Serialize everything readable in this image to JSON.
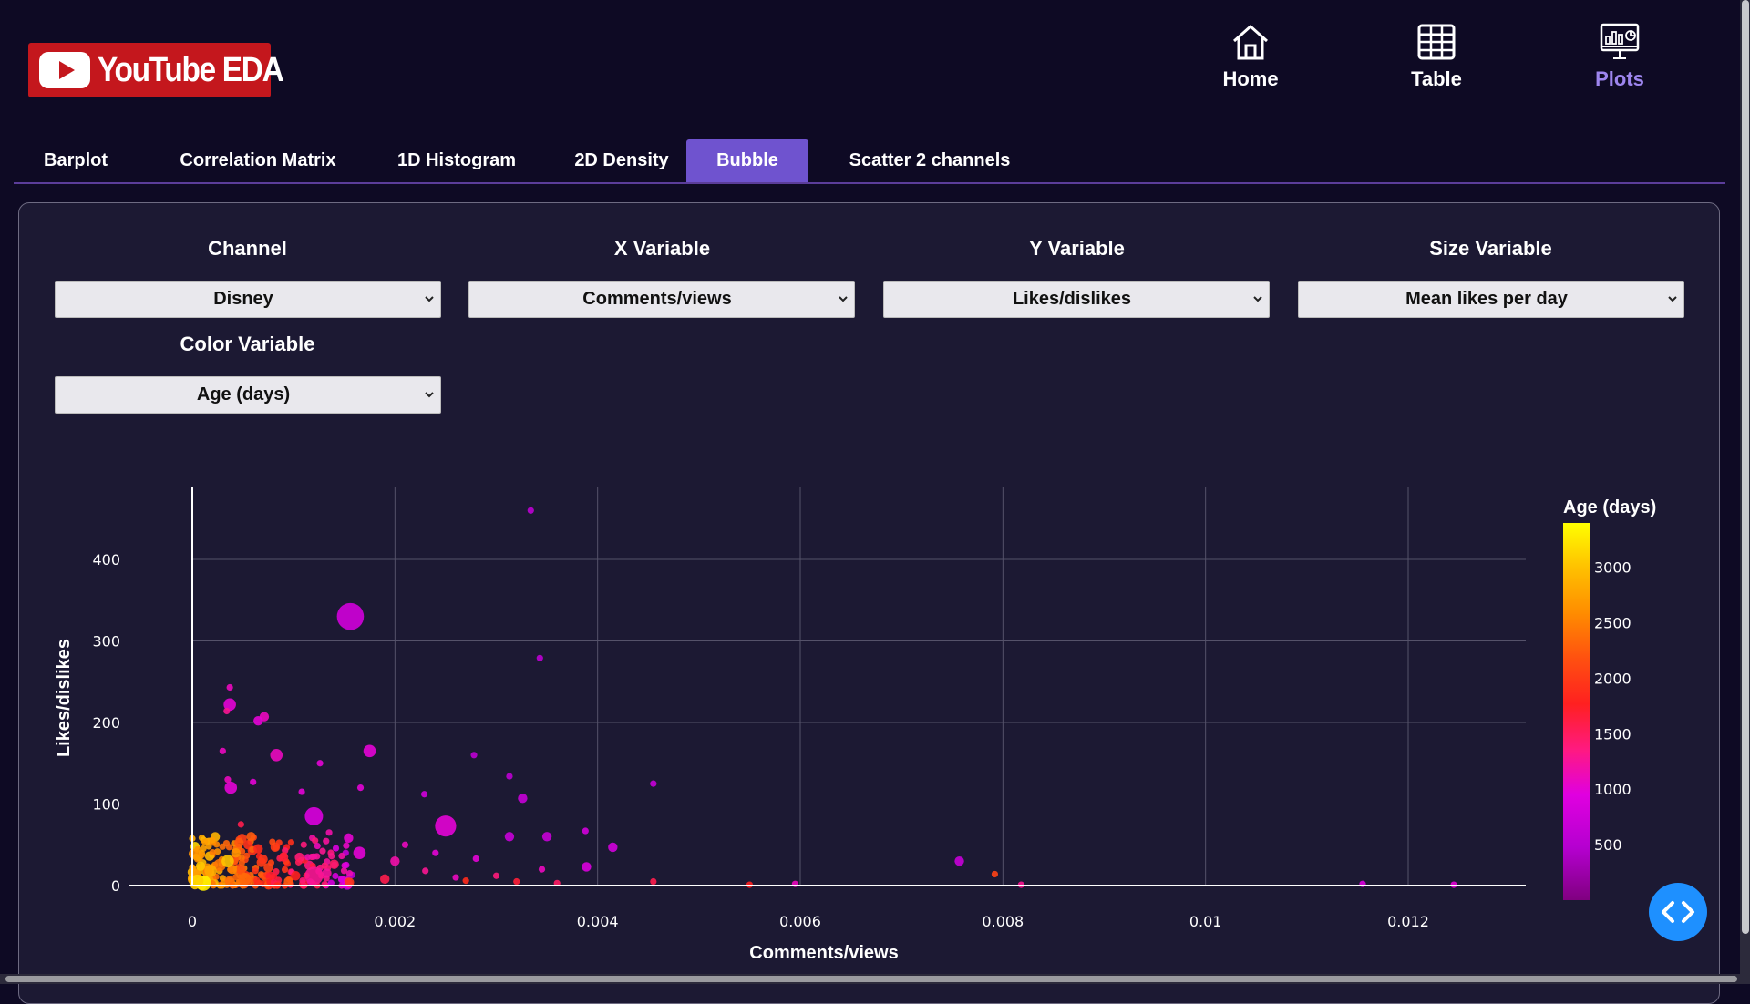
{
  "app": {
    "logo_text": "YouTube EDA",
    "brand_color": "#c4171d"
  },
  "nav": [
    {
      "label": "Home",
      "icon": "home-icon",
      "active": false
    },
    {
      "label": "Table",
      "icon": "table-grid-icon",
      "active": false
    },
    {
      "label": "Plots",
      "icon": "presentation-chart-icon",
      "active": true
    }
  ],
  "tabs": [
    {
      "label": "Barplot",
      "active": false
    },
    {
      "label": "Correlation Matrix",
      "active": false
    },
    {
      "label": "1D Histogram",
      "active": false
    },
    {
      "label": "2D Density",
      "active": false
    },
    {
      "label": "Bubble",
      "active": true
    },
    {
      "label": "Scatter 2 channels",
      "active": false
    }
  ],
  "controls": {
    "channel": {
      "label": "Channel",
      "value": "Disney"
    },
    "x_variable": {
      "label": "X Variable",
      "value": "Comments/views"
    },
    "y_variable": {
      "label": "Y Variable",
      "value": "Likes/dislikes"
    },
    "size_variable": {
      "label": "Size Variable",
      "value": "Mean likes per day"
    },
    "color_variable": {
      "label": "Color Variable",
      "value": "Age (days)"
    }
  },
  "chart_data": {
    "type": "scatter",
    "xlabel": "Comments/views",
    "ylabel": "Likes/dislikes",
    "xlim": [
      -0.0005,
      0.0132
    ],
    "ylim": [
      -20,
      490
    ],
    "x_ticks": [
      "0",
      "0.002",
      "0.004",
      "0.006",
      "0.008",
      "0.01",
      "0.012"
    ],
    "x_tick_values": [
      0,
      0.002,
      0.004,
      0.006,
      0.008,
      0.01,
      0.012
    ],
    "y_ticks": [
      "0",
      "100",
      "200",
      "300",
      "400"
    ],
    "y_tick_values": [
      0,
      100,
      200,
      300,
      400
    ],
    "grid": true,
    "colorbar": {
      "title": "Age (days)",
      "ticks": [
        "500",
        "1000",
        "1500",
        "2000",
        "2500",
        "3000"
      ],
      "tick_values": [
        500,
        1000,
        1500,
        2000,
        2500,
        3000
      ],
      "range": [
        0,
        3400
      ],
      "colorscale": [
        "#800080",
        "#b500d0",
        "#e000e0",
        "#ff1a80",
        "#ff2020",
        "#ff5010",
        "#ff8c00",
        "#ffc000",
        "#ffff00"
      ]
    },
    "points": [
      [
        0.00334,
        460,
        500,
        1
      ],
      [
        0.00156,
        330,
        700,
        8
      ],
      [
        0.00037,
        243,
        1000,
        1
      ],
      [
        0.00037,
        222,
        900,
        3
      ],
      [
        0.00034,
        214,
        1200,
        1
      ],
      [
        0.00071,
        207,
        1000,
        2
      ],
      [
        0.00065,
        202,
        900,
        2
      ],
      [
        0.00083,
        160,
        1000,
        3
      ],
      [
        0.00175,
        165,
        900,
        3
      ],
      [
        0.00343,
        279,
        500,
        1
      ],
      [
        0.00038,
        120,
        900,
        3
      ],
      [
        0.00035,
        130,
        1000,
        1
      ],
      [
        0.0003,
        165,
        1000,
        1
      ],
      [
        0.00108,
        115,
        900,
        1
      ],
      [
        0.00126,
        150,
        900,
        1
      ],
      [
        0.0006,
        127,
        900,
        1
      ],
      [
        0.0012,
        85,
        800,
        5
      ],
      [
        0.00278,
        160,
        500,
        1
      ],
      [
        0.00313,
        134,
        500,
        1
      ],
      [
        0.00326,
        107,
        600,
        2
      ],
      [
        0.00229,
        112,
        700,
        1
      ],
      [
        0.00455,
        125,
        600,
        1
      ],
      [
        0.0025,
        73,
        900,
        6
      ],
      [
        0.00165,
        40,
        900,
        3
      ],
      [
        0.00166,
        120,
        900,
        1
      ],
      [
        0.00313,
        60,
        600,
        2
      ],
      [
        0.0035,
        60,
        600,
        2
      ],
      [
        0.00388,
        67,
        700,
        1
      ],
      [
        0.00415,
        47,
        700,
        2
      ],
      [
        0.00389,
        23,
        800,
        2
      ],
      [
        0.0012,
        12,
        1200,
        5
      ],
      [
        0.00757,
        30,
        600,
        2
      ],
      [
        0.00792,
        14,
        2000,
        1
      ],
      [
        0.00818,
        1,
        1200,
        1
      ],
      [
        0.0055,
        1,
        1700,
        1
      ],
      [
        0.00595,
        2,
        1000,
        1
      ],
      [
        0.01155,
        2,
        800,
        1
      ],
      [
        0.01245,
        1,
        900,
        1
      ],
      [
        0.00455,
        5,
        1500,
        1
      ],
      [
        0.00011,
        3,
        3300,
        4
      ],
      [
        5e-05,
        6,
        3100,
        3
      ],
      [
        0.00027,
        25,
        2400,
        3
      ],
      [
        0.00035,
        30,
        3000,
        3
      ],
      [
        0.00043,
        40,
        2600,
        2
      ],
      [
        0.00058,
        60,
        2200,
        2
      ],
      [
        0.00018,
        18,
        2800,
        3
      ],
      [
        0.00052,
        8,
        2300,
        3
      ],
      [
        0.00075,
        22,
        2000,
        2
      ],
      [
        0.0009,
        35,
        1600,
        2
      ],
      [
        0.00102,
        12,
        1700,
        2
      ],
      [
        0.0014,
        26,
        1400,
        2
      ],
      [
        0.002,
        30,
        1100,
        2
      ],
      [
        0.0023,
        18,
        1200,
        1
      ],
      [
        0.0026,
        10,
        1000,
        1
      ],
      [
        0.0028,
        33,
        900,
        1
      ],
      [
        0.003,
        12,
        1300,
        1
      ],
      [
        0.00345,
        20,
        1000,
        1
      ],
      [
        0.0036,
        3,
        1400,
        1
      ],
      [
        0.0032,
        5,
        1600,
        1
      ],
      [
        0.0027,
        6,
        1800,
        1
      ],
      [
        0.0019,
        8,
        1500,
        2
      ],
      [
        0.00155,
        4,
        1900,
        2
      ],
      [
        0.00095,
        5,
        2200,
        2
      ],
      [
        0.00065,
        45,
        1800,
        2
      ],
      [
        0.00048,
        75,
        1500,
        1
      ],
      [
        0.0011,
        50,
        1300,
        1
      ],
      [
        0.00135,
        65,
        1100,
        1
      ],
      [
        0.0021,
        50,
        1000,
        1
      ],
      [
        0.0024,
        40,
        900,
        1
      ]
    ]
  }
}
